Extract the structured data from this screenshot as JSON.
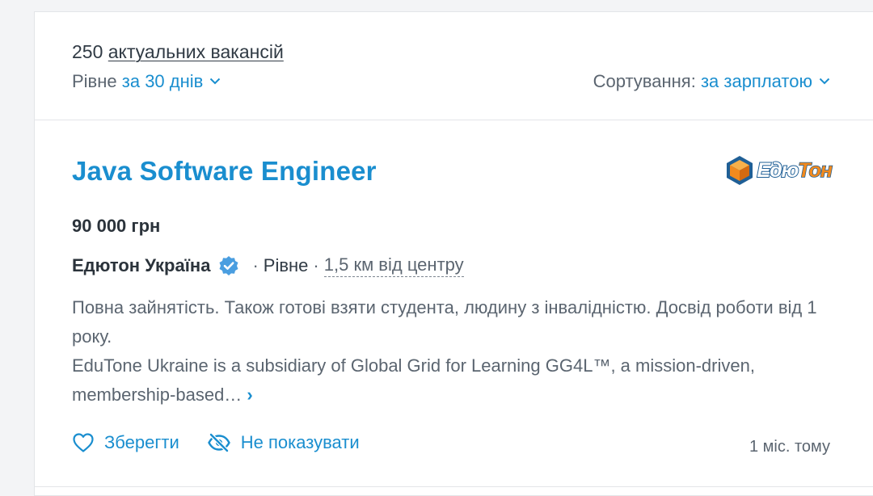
{
  "summary": {
    "count": "250",
    "count_link": "актуальних вакансій",
    "city": "Рівне",
    "period": "за 30 днів",
    "sort_label": "Сортування:",
    "sort_value": "за зарплатою"
  },
  "job": {
    "title": "Java Software Engineer",
    "logo": {
      "part1": "Едю",
      "part2": "Тон"
    },
    "salary": "90 000 грн",
    "company": "Едютон Україна",
    "separator": "·",
    "city": "Рівне",
    "distance": "1,5 км від центру",
    "description_line1": "Повна зайнятість. Також готові взяти студента, людину з інвалідністю. Досвід роботи від 1 року.",
    "description_line2": "EduTone Ukraine is a subsidiary of Global Grid for Learning GG4L™, a mission-driven, membership-based…",
    "more_symbol": "›",
    "save_label": "Зберегти",
    "hide_label": "Не показувати",
    "age": "1 міс. тому"
  },
  "colors": {
    "accent": "#1a8ecf",
    "text": "#303a44",
    "muted": "#5b6570",
    "logo_orange": "#f28a1e",
    "logo_blue": "#1f5f96"
  },
  "icons": [
    "chevron-down-icon",
    "verified-icon",
    "heart-icon",
    "eye-off-icon",
    "cube-logo-icon"
  ]
}
